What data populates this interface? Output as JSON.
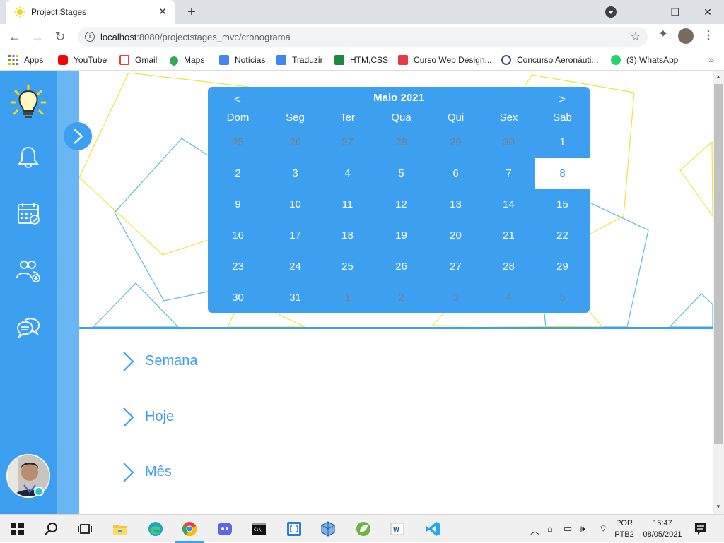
{
  "browser": {
    "tab_title": "Project Stages",
    "url_host": "localhost",
    "url_port_path": ":8080/projectstages_mvc/cronograma",
    "bookmarks": [
      {
        "label": "Apps",
        "color": "#4285f4"
      },
      {
        "label": "YouTube",
        "color": "#ff0000"
      },
      {
        "label": "Gmail",
        "color": "#ea4335"
      },
      {
        "label": "Maps",
        "color": "#34a853"
      },
      {
        "label": "Notícias",
        "color": "#4285f4"
      },
      {
        "label": "Traduzir",
        "color": "#4285f4"
      },
      {
        "label": "HTM,CSS",
        "color": "#1c8a3c"
      },
      {
        "label": "Curso Web Design...",
        "color": "#e63946"
      },
      {
        "label": "Concurso Aeronáuti...",
        "color": "#3b4a8c"
      },
      {
        "label": "(3) WhatsApp",
        "color": "#25d366"
      }
    ]
  },
  "calendar": {
    "title": "Maio 2021",
    "prev": "<",
    "next": ">",
    "weekdays": [
      "Dom",
      "Seg",
      "Ter",
      "Qua",
      "Qui",
      "Sex",
      "Sab"
    ],
    "weeks": [
      [
        {
          "d": "25",
          "m": true
        },
        {
          "d": "26",
          "m": true
        },
        {
          "d": "27",
          "m": true
        },
        {
          "d": "28",
          "m": true
        },
        {
          "d": "29",
          "m": true
        },
        {
          "d": "30",
          "m": true
        },
        {
          "d": "1"
        }
      ],
      [
        {
          "d": "2"
        },
        {
          "d": "3"
        },
        {
          "d": "4"
        },
        {
          "d": "5"
        },
        {
          "d": "6"
        },
        {
          "d": "7"
        },
        {
          "d": "8",
          "a": true
        }
      ],
      [
        {
          "d": "9"
        },
        {
          "d": "10"
        },
        {
          "d": "11"
        },
        {
          "d": "12"
        },
        {
          "d": "13"
        },
        {
          "d": "14"
        },
        {
          "d": "15"
        }
      ],
      [
        {
          "d": "16"
        },
        {
          "d": "17"
        },
        {
          "d": "18"
        },
        {
          "d": "19"
        },
        {
          "d": "20"
        },
        {
          "d": "21"
        },
        {
          "d": "22"
        }
      ],
      [
        {
          "d": "23"
        },
        {
          "d": "24"
        },
        {
          "d": "25"
        },
        {
          "d": "26"
        },
        {
          "d": "27"
        },
        {
          "d": "28"
        },
        {
          "d": "29"
        }
      ],
      [
        {
          "d": "30"
        },
        {
          "d": "31"
        },
        {
          "d": "1",
          "m": true
        },
        {
          "d": "2",
          "m": true
        },
        {
          "d": "3",
          "m": true
        },
        {
          "d": "4",
          "m": true
        },
        {
          "d": "5",
          "m": true
        }
      ]
    ]
  },
  "menu": {
    "items": [
      "Semana",
      "Hoje",
      "Mês"
    ]
  },
  "sidebar": {
    "icons": [
      "lightbulb-logo-icon",
      "bell-icon",
      "calendar-check-icon",
      "users-add-icon",
      "chat-icon"
    ]
  },
  "taskbar": {
    "lang_line1": "POR",
    "lang_line2": "PTB2",
    "time": "15:47",
    "date": "08/05/2021"
  },
  "colors": {
    "primary": "#3d9ff0",
    "sidebar_strip": "#6ab6f5",
    "muted_day": "#7d7d7d",
    "online": "#27c6d1"
  }
}
